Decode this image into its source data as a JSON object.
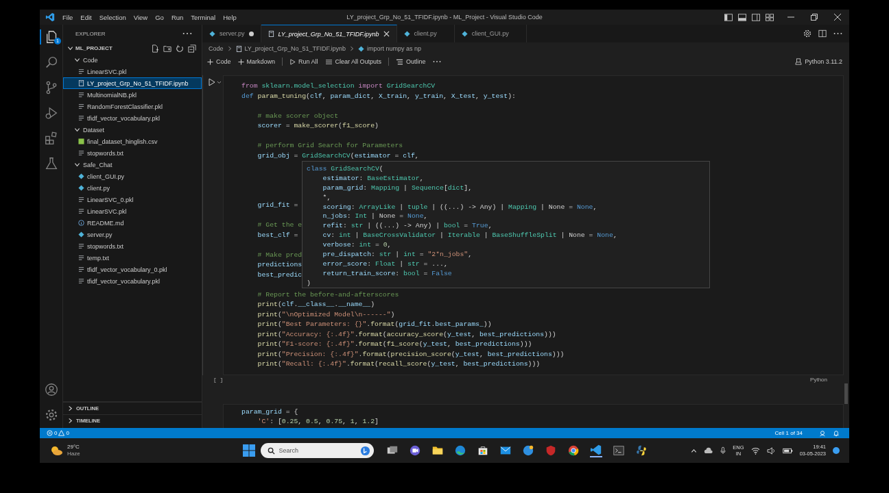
{
  "window": {
    "title": "LY_project_Grp_No_51_TFIDF.ipynb - ML_Project - Visual Studio Code"
  },
  "menu": [
    "File",
    "Edit",
    "Selection",
    "View",
    "Go",
    "Run",
    "Terminal",
    "Help"
  ],
  "activity_bar": {
    "explorer_badge": "1"
  },
  "explorer": {
    "title": "EXPLORER",
    "root": {
      "label": "ML_PROJECT",
      "expanded": true,
      "children": [
        {
          "label": "Code",
          "expanded": true,
          "selected": false,
          "children": [
            {
              "label": "LinearSVC.pkl",
              "kind": "pkl",
              "selected": false
            },
            {
              "label": "LY_project_Grp_No_51_TFIDF.ipynb",
              "kind": "ipynb",
              "selected": true
            },
            {
              "label": "MultinomialNB.pkl",
              "kind": "pkl",
              "selected": false
            },
            {
              "label": "RandomForestClassifier.pkl",
              "kind": "pkl",
              "selected": false
            },
            {
              "label": "tfidf_vector_vocabulary.pkl",
              "kind": "pkl",
              "selected": false
            }
          ]
        },
        {
          "label": "Dataset",
          "expanded": true,
          "selected": false,
          "children": [
            {
              "label": "final_dataset_hinglish.csv",
              "kind": "csv",
              "selected": false
            },
            {
              "label": "stopwords.txt",
              "kind": "txt",
              "selected": false
            }
          ]
        },
        {
          "label": "Safe_Chat",
          "expanded": true,
          "selected": false,
          "children": [
            {
              "label": "client_GUI.py",
              "kind": "py",
              "selected": false
            },
            {
              "label": "client.py",
              "kind": "py",
              "selected": false
            },
            {
              "label": "LinearSVC_0.pkl",
              "kind": "pkl",
              "selected": false
            },
            {
              "label": "LinearSVC.pkl",
              "kind": "pkl",
              "selected": false
            },
            {
              "label": "README.md",
              "kind": "md",
              "selected": false
            },
            {
              "label": "server.py",
              "kind": "py",
              "selected": false
            },
            {
              "label": "stopwords.txt",
              "kind": "txt",
              "selected": false
            },
            {
              "label": "temp.txt",
              "kind": "txt",
              "selected": false
            },
            {
              "label": "tfidf_vector_vocabulary_0.pkl",
              "kind": "pkl",
              "selected": false
            },
            {
              "label": "tfidf_vector_vocabulary.pkl",
              "kind": "pkl",
              "selected": false
            }
          ]
        }
      ]
    },
    "panels": [
      {
        "label": "OUTLINE",
        "expanded": false
      },
      {
        "label": "TIMELINE",
        "expanded": false
      }
    ]
  },
  "tabs": [
    {
      "label": "server.py",
      "kind": "py",
      "selected": false,
      "modified": true,
      "preview": false
    },
    {
      "label": "LY_project_Grp_No_51_TFIDF.ipynb",
      "kind": "ipynb",
      "selected": true,
      "modified": false,
      "preview": true
    },
    {
      "label": "client.py",
      "kind": "py",
      "selected": false,
      "modified": false,
      "preview": false
    },
    {
      "label": "client_GUI.py",
      "kind": "py",
      "selected": false,
      "modified": false,
      "preview": false
    }
  ],
  "breadcrumb": [
    {
      "label": "Code",
      "kind": "folder"
    },
    {
      "label": "LY_project_Grp_No_51_TFIDF.ipynb",
      "kind": "ipynb"
    },
    {
      "label": "import numpy as np",
      "kind": "symbol"
    }
  ],
  "toolbar": [
    {
      "label": "Code",
      "kind": "add"
    },
    {
      "label": "Markdown",
      "kind": "add"
    },
    {
      "label": "Run All",
      "kind": "run"
    },
    {
      "label": "Clear All Outputs",
      "kind": "clear"
    },
    {
      "label": "Outline",
      "kind": "outline"
    },
    {
      "kind": "more"
    }
  ],
  "kernel": "Python 3.11.2",
  "cells": [
    {
      "execution_count": "[ ]",
      "language": "Python",
      "lines": [
        {
          "tokens": [
            {
              "text": "from ",
              "kind": "ctrl"
            },
            {
              "text": "sklearn.model_selection",
              "kind": "cls"
            },
            {
              "text": " import ",
              "kind": "ctrl"
            },
            {
              "text": "GridSearchCV",
              "kind": "cls"
            }
          ]
        },
        {
          "tokens": [
            {
              "text": "def ",
              "kind": "kw"
            },
            {
              "text": "param_tuning",
              "kind": "fn"
            },
            {
              "text": "(",
              "kind": "p"
            },
            {
              "text": "clf",
              "kind": "var"
            },
            {
              "text": ", ",
              "kind": "p"
            },
            {
              "text": "param_dict",
              "kind": "var"
            },
            {
              "text": ", ",
              "kind": "p"
            },
            {
              "text": "X_train",
              "kind": "var"
            },
            {
              "text": ", ",
              "kind": "p"
            },
            {
              "text": "y_train",
              "kind": "var"
            },
            {
              "text": ", ",
              "kind": "p"
            },
            {
              "text": "X_test",
              "kind": "var"
            },
            {
              "text": ", ",
              "kind": "p"
            },
            {
              "text": "y_test",
              "kind": "var"
            },
            {
              "text": "):",
              "kind": "p"
            }
          ]
        },
        {
          "kind": "blank"
        },
        {
          "tokens": [
            {
              "text": "    # make scorer object",
              "kind": "cm"
            }
          ]
        },
        {
          "tokens": [
            {
              "text": "    scorer",
              "kind": "var"
            },
            {
              "text": " = ",
              "kind": "p"
            },
            {
              "text": "make_scorer",
              "kind": "fn"
            },
            {
              "text": "(",
              "kind": "p"
            },
            {
              "text": "f1_score",
              "kind": "fn"
            },
            {
              "text": ")",
              "kind": "p"
            }
          ]
        },
        {
          "kind": "blank"
        },
        {
          "tokens": [
            {
              "text": "    # perform Grid Search for Parameters",
              "kind": "cm"
            }
          ]
        },
        {
          "tokens": [
            {
              "text": "    grid_obj",
              "kind": "var"
            },
            {
              "text": " = ",
              "kind": "p"
            },
            {
              "text": "GridSearchCV",
              "kind": "cls"
            },
            {
              "text": "(",
              "kind": "p"
            },
            {
              "text": "estimator",
              "kind": "var"
            },
            {
              "text": " = ",
              "kind": "p"
            },
            {
              "text": "clf",
              "kind": "var"
            },
            {
              "text": ",",
              "kind": "p"
            }
          ]
        },
        {
          "kind": "blank"
        },
        {
          "kind": "blank"
        },
        {
          "kind": "blank"
        },
        {
          "kind": "blank"
        },
        {
          "tokens": [
            {
              "text": "    grid_fit",
              "kind": "var"
            },
            {
              "text": " =",
              "kind": "p"
            }
          ]
        },
        {
          "kind": "blank"
        },
        {
          "tokens": [
            {
              "text": "    # Get the e",
              "kind": "cm"
            }
          ]
        },
        {
          "tokens": [
            {
              "text": "    best_clf",
              "kind": "var"
            },
            {
              "text": " =",
              "kind": "p"
            }
          ]
        },
        {
          "kind": "blank"
        },
        {
          "tokens": [
            {
              "text": "    # Make pred",
              "kind": "cm"
            }
          ]
        },
        {
          "tokens": [
            {
              "text": "    predictions",
              "kind": "var"
            }
          ]
        },
        {
          "tokens": [
            {
              "text": "    best_predic",
              "kind": "var"
            }
          ]
        },
        {
          "kind": "blank"
        },
        {
          "tokens": [
            {
              "text": "    # Report the before-and-afterscores",
              "kind": "cm"
            }
          ]
        },
        {
          "tokens": [
            {
              "text": "    print",
              "kind": "fn"
            },
            {
              "text": "(",
              "kind": "p"
            },
            {
              "text": "clf",
              "kind": "var"
            },
            {
              "text": ".",
              "kind": "p"
            },
            {
              "text": "__class__",
              "kind": "var"
            },
            {
              "text": ".",
              "kind": "p"
            },
            {
              "text": "__name__",
              "kind": "var"
            },
            {
              "text": ")",
              "kind": "p"
            }
          ]
        },
        {
          "tokens": [
            {
              "text": "    print",
              "kind": "fn"
            },
            {
              "text": "(",
              "kind": "p"
            },
            {
              "text": "\"\\nOptimized Model\\n------\"",
              "kind": "str"
            },
            {
              "text": ")",
              "kind": "p"
            }
          ]
        },
        {
          "tokens": [
            {
              "text": "    print",
              "kind": "fn"
            },
            {
              "text": "(",
              "kind": "p"
            },
            {
              "text": "\"Best Parameters: {}\"",
              "kind": "str"
            },
            {
              "text": ".",
              "kind": "p"
            },
            {
              "text": "format",
              "kind": "fn"
            },
            {
              "text": "(",
              "kind": "p"
            },
            {
              "text": "grid_fit",
              "kind": "var"
            },
            {
              "text": ".",
              "kind": "p"
            },
            {
              "text": "best_params_",
              "kind": "var"
            },
            {
              "text": "))",
              "kind": "p"
            }
          ]
        },
        {
          "tokens": [
            {
              "text": "    print",
              "kind": "fn"
            },
            {
              "text": "(",
              "kind": "p"
            },
            {
              "text": "\"Accuracy: {:.4f}\"",
              "kind": "str"
            },
            {
              "text": ".",
              "kind": "p"
            },
            {
              "text": "format",
              "kind": "fn"
            },
            {
              "text": "(",
              "kind": "p"
            },
            {
              "text": "accuracy_score",
              "kind": "fn"
            },
            {
              "text": "(",
              "kind": "p"
            },
            {
              "text": "y_test",
              "kind": "var"
            },
            {
              "text": ", ",
              "kind": "p"
            },
            {
              "text": "best_predictions",
              "kind": "var"
            },
            {
              "text": ")))",
              "kind": "p"
            }
          ]
        },
        {
          "tokens": [
            {
              "text": "    print",
              "kind": "fn"
            },
            {
              "text": "(",
              "kind": "p"
            },
            {
              "text": "\"F1-score: {:.4f}\"",
              "kind": "str"
            },
            {
              "text": ".",
              "kind": "p"
            },
            {
              "text": "format",
              "kind": "fn"
            },
            {
              "text": "(",
              "kind": "p"
            },
            {
              "text": "f1_score",
              "kind": "fn"
            },
            {
              "text": "(",
              "kind": "p"
            },
            {
              "text": "y_test",
              "kind": "var"
            },
            {
              "text": ", ",
              "kind": "p"
            },
            {
              "text": "best_predictions",
              "kind": "var"
            },
            {
              "text": ")))",
              "kind": "p"
            }
          ]
        },
        {
          "tokens": [
            {
              "text": "    print",
              "kind": "fn"
            },
            {
              "text": "(",
              "kind": "p"
            },
            {
              "text": "\"Precision: {:.4f}\"",
              "kind": "str"
            },
            {
              "text": ".",
              "kind": "p"
            },
            {
              "text": "format",
              "kind": "fn"
            },
            {
              "text": "(",
              "kind": "p"
            },
            {
              "text": "precision_score",
              "kind": "fn"
            },
            {
              "text": "(",
              "kind": "p"
            },
            {
              "text": "y_test",
              "kind": "var"
            },
            {
              "text": ", ",
              "kind": "p"
            },
            {
              "text": "best_predictions",
              "kind": "var"
            },
            {
              "text": ")))",
              "kind": "p"
            }
          ]
        },
        {
          "tokens": [
            {
              "text": "    print",
              "kind": "fn"
            },
            {
              "text": "(",
              "kind": "p"
            },
            {
              "text": "\"Recall: {:.4f}\"",
              "kind": "str"
            },
            {
              "text": ".",
              "kind": "p"
            },
            {
              "text": "format",
              "kind": "fn"
            },
            {
              "text": "(",
              "kind": "p"
            },
            {
              "text": "recall_score",
              "kind": "fn"
            },
            {
              "text": "(",
              "kind": "p"
            },
            {
              "text": "y_test",
              "kind": "var"
            },
            {
              "text": ", ",
              "kind": "p"
            },
            {
              "text": "best_predictions",
              "kind": "var"
            },
            {
              "text": ")))",
              "kind": "p"
            }
          ]
        }
      ],
      "popup": {
        "lines": [
          {
            "tokens": [
              {
                "text": "class ",
                "kind": "kw"
              },
              {
                "text": "GridSearchCV",
                "kind": "cls"
              },
              {
                "text": "(",
                "kind": "p"
              }
            ]
          },
          {
            "tokens": [
              {
                "text": "    estimator",
                "kind": "var"
              },
              {
                "text": ": ",
                "kind": "p"
              },
              {
                "text": "BaseEstimator",
                "kind": "cls"
              },
              {
                "text": ",",
                "kind": "p"
              }
            ]
          },
          {
            "tokens": [
              {
                "text": "    param_grid",
                "kind": "var"
              },
              {
                "text": ": ",
                "kind": "p"
              },
              {
                "text": "Mapping",
                "kind": "cls"
              },
              {
                "text": " | ",
                "kind": "p"
              },
              {
                "text": "Sequence",
                "kind": "cls"
              },
              {
                "text": "[",
                "kind": "p"
              },
              {
                "text": "dict",
                "kind": "cls"
              },
              {
                "text": "],",
                "kind": "p"
              }
            ]
          },
          {
            "tokens": [
              {
                "text": "    *,",
                "kind": "p"
              }
            ]
          },
          {
            "tokens": [
              {
                "text": "    scoring",
                "kind": "var"
              },
              {
                "text": ": ",
                "kind": "p"
              },
              {
                "text": "ArrayLike",
                "kind": "cls"
              },
              {
                "text": " | ",
                "kind": "p"
              },
              {
                "text": "tuple",
                "kind": "cls"
              },
              {
                "text": " | ((...) -> Any) | ",
                "kind": "p"
              },
              {
                "text": "Mapping",
                "kind": "cls"
              },
              {
                "text": " | None = ",
                "kind": "p"
              },
              {
                "text": "None",
                "kind": "kw"
              },
              {
                "text": ",",
                "kind": "p"
              }
            ]
          },
          {
            "tokens": [
              {
                "text": "    n_jobs",
                "kind": "var"
              },
              {
                "text": ": ",
                "kind": "p"
              },
              {
                "text": "Int",
                "kind": "cls"
              },
              {
                "text": " | None = ",
                "kind": "p"
              },
              {
                "text": "None",
                "kind": "kw"
              },
              {
                "text": ",",
                "kind": "p"
              }
            ]
          },
          {
            "tokens": [
              {
                "text": "    refit",
                "kind": "var"
              },
              {
                "text": ": ",
                "kind": "p"
              },
              {
                "text": "str",
                "kind": "cls"
              },
              {
                "text": " | ((...) -> Any) | ",
                "kind": "p"
              },
              {
                "text": "bool",
                "kind": "cls"
              },
              {
                "text": " = ",
                "kind": "p"
              },
              {
                "text": "True",
                "kind": "kw"
              },
              {
                "text": ",",
                "kind": "p"
              }
            ]
          },
          {
            "tokens": [
              {
                "text": "    cv",
                "kind": "var"
              },
              {
                "text": ": ",
                "kind": "p"
              },
              {
                "text": "int",
                "kind": "cls"
              },
              {
                "text": " | ",
                "kind": "p"
              },
              {
                "text": "BaseCrossValidator",
                "kind": "cls"
              },
              {
                "text": " | ",
                "kind": "p"
              },
              {
                "text": "Iterable",
                "kind": "cls"
              },
              {
                "text": " | ",
                "kind": "p"
              },
              {
                "text": "BaseShuffleSplit",
                "kind": "cls"
              },
              {
                "text": " | None = ",
                "kind": "p"
              },
              {
                "text": "None",
                "kind": "kw"
              },
              {
                "text": ",",
                "kind": "p"
              }
            ]
          },
          {
            "tokens": [
              {
                "text": "    verbose",
                "kind": "var"
              },
              {
                "text": ": ",
                "kind": "p"
              },
              {
                "text": "int",
                "kind": "cls"
              },
              {
                "text": " = ",
                "kind": "p"
              },
              {
                "text": "0",
                "kind": "num"
              },
              {
                "text": ",",
                "kind": "p"
              }
            ]
          },
          {
            "tokens": [
              {
                "text": "    pre_dispatch",
                "kind": "var"
              },
              {
                "text": ": ",
                "kind": "p"
              },
              {
                "text": "str",
                "kind": "cls"
              },
              {
                "text": " | ",
                "kind": "p"
              },
              {
                "text": "int",
                "kind": "cls"
              },
              {
                "text": " = ",
                "kind": "p"
              },
              {
                "text": "\"2*n_jobs\"",
                "kind": "str"
              },
              {
                "text": ",",
                "kind": "p"
              }
            ]
          },
          {
            "tokens": [
              {
                "text": "    error_score",
                "kind": "var"
              },
              {
                "text": ": ",
                "kind": "p"
              },
              {
                "text": "Float",
                "kind": "cls"
              },
              {
                "text": " | ",
                "kind": "p"
              },
              {
                "text": "str",
                "kind": "cls"
              },
              {
                "text": " = ...,",
                "kind": "p"
              }
            ]
          },
          {
            "tokens": [
              {
                "text": "    return_train_score",
                "kind": "var"
              },
              {
                "text": ": ",
                "kind": "p"
              },
              {
                "text": "bool",
                "kind": "cls"
              },
              {
                "text": " = ",
                "kind": "p"
              },
              {
                "text": "False",
                "kind": "kw"
              }
            ]
          },
          {
            "tokens": [
              {
                "text": ")",
                "kind": "p"
              }
            ]
          }
        ]
      }
    },
    {
      "lines": [
        {
          "tokens": [
            {
              "text": "param_grid",
              "kind": "var"
            },
            {
              "text": " = {",
              "kind": "p"
            }
          ]
        },
        {
          "tokens": [
            {
              "text": "    'C'",
              "kind": "str"
            },
            {
              "text": ": [",
              "kind": "p"
            },
            {
              "text": "0.25",
              "kind": "num"
            },
            {
              "text": ", ",
              "kind": "p"
            },
            {
              "text": "0.5",
              "kind": "num"
            },
            {
              "text": ", ",
              "kind": "p"
            },
            {
              "text": "0.75",
              "kind": "num"
            },
            {
              "text": ", ",
              "kind": "p"
            },
            {
              "text": "1",
              "kind": "num"
            },
            {
              "text": ", ",
              "kind": "p"
            },
            {
              "text": "1.2",
              "kind": "num"
            },
            {
              "text": "]",
              "kind": "p"
            }
          ]
        }
      ]
    }
  ],
  "status_bar": {
    "errors": "0",
    "warnings": "0",
    "cell": "Cell 1 of 34"
  },
  "taskbar": {
    "weather": {
      "temp": "29°C",
      "condition": "Haze"
    },
    "search": {
      "placeholder": "Search"
    },
    "tray": {
      "language": "ENG",
      "region": "IN",
      "time": "19:41",
      "date": "03-05-2023"
    }
  }
}
